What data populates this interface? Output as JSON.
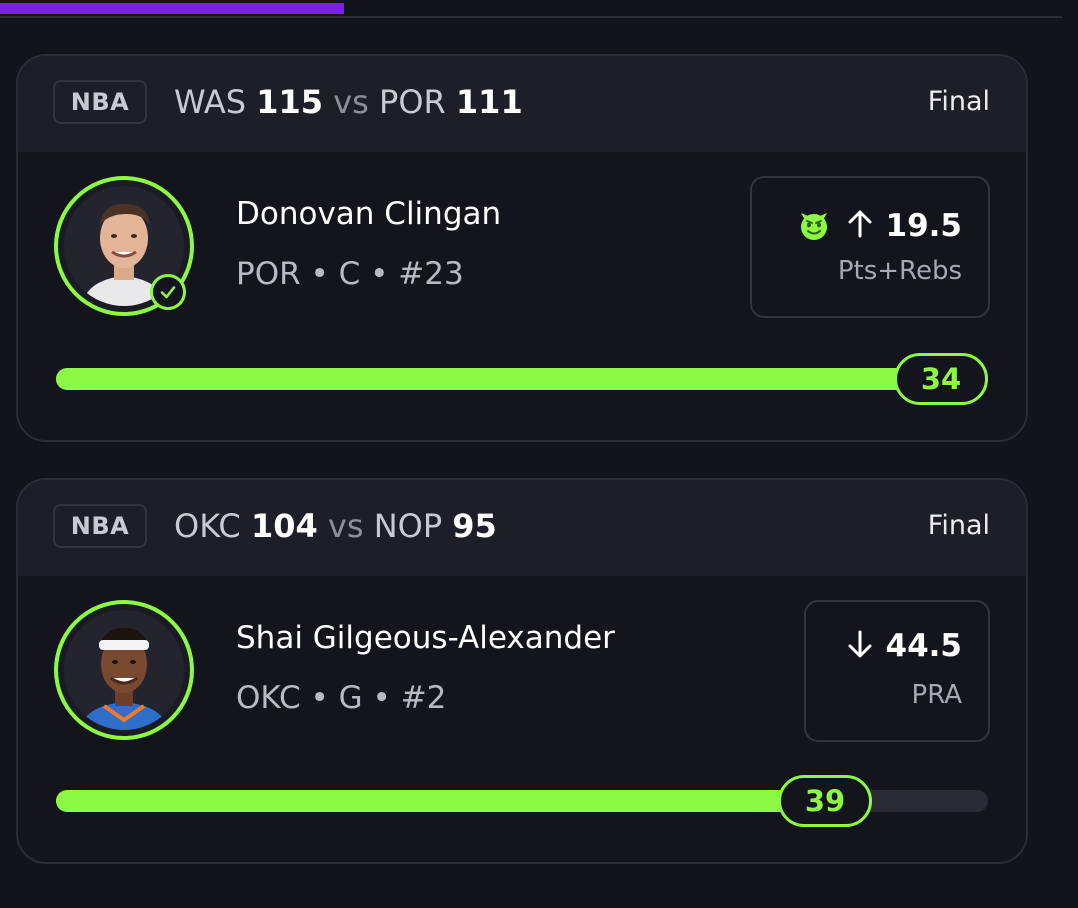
{
  "accent_color": "#8cfa42",
  "progress_color": "#7a1fe6",
  "cards": [
    {
      "league": "NBA",
      "away_team": "WAS",
      "away_score": "115",
      "vs": "vs",
      "home_team": "POR",
      "home_score": "111",
      "status": "Final",
      "player_name": "Donovan Clingan",
      "player_meta": "POR • C • #23",
      "direction": "up",
      "direction_icon": "arrow-up-icon",
      "line": "19.5",
      "stat": "Pts+Rebs",
      "badge_icon": "devil-emoji-icon",
      "result": "34",
      "result_value": 34,
      "progress_fraction": 1.0,
      "verified_icon": "check-icon"
    },
    {
      "league": "NBA",
      "away_team": "OKC",
      "away_score": "104",
      "vs": "vs",
      "home_team": "NOP",
      "home_score": "95",
      "status": "Final",
      "player_name": "Shai Gilgeous-Alexander",
      "player_meta": "OKC • G • #2",
      "direction": "down",
      "direction_icon": "arrow-down-icon",
      "line": "44.5",
      "stat": "PRA",
      "result": "39",
      "result_value": 39,
      "progress_fraction": 0.876
    }
  ]
}
